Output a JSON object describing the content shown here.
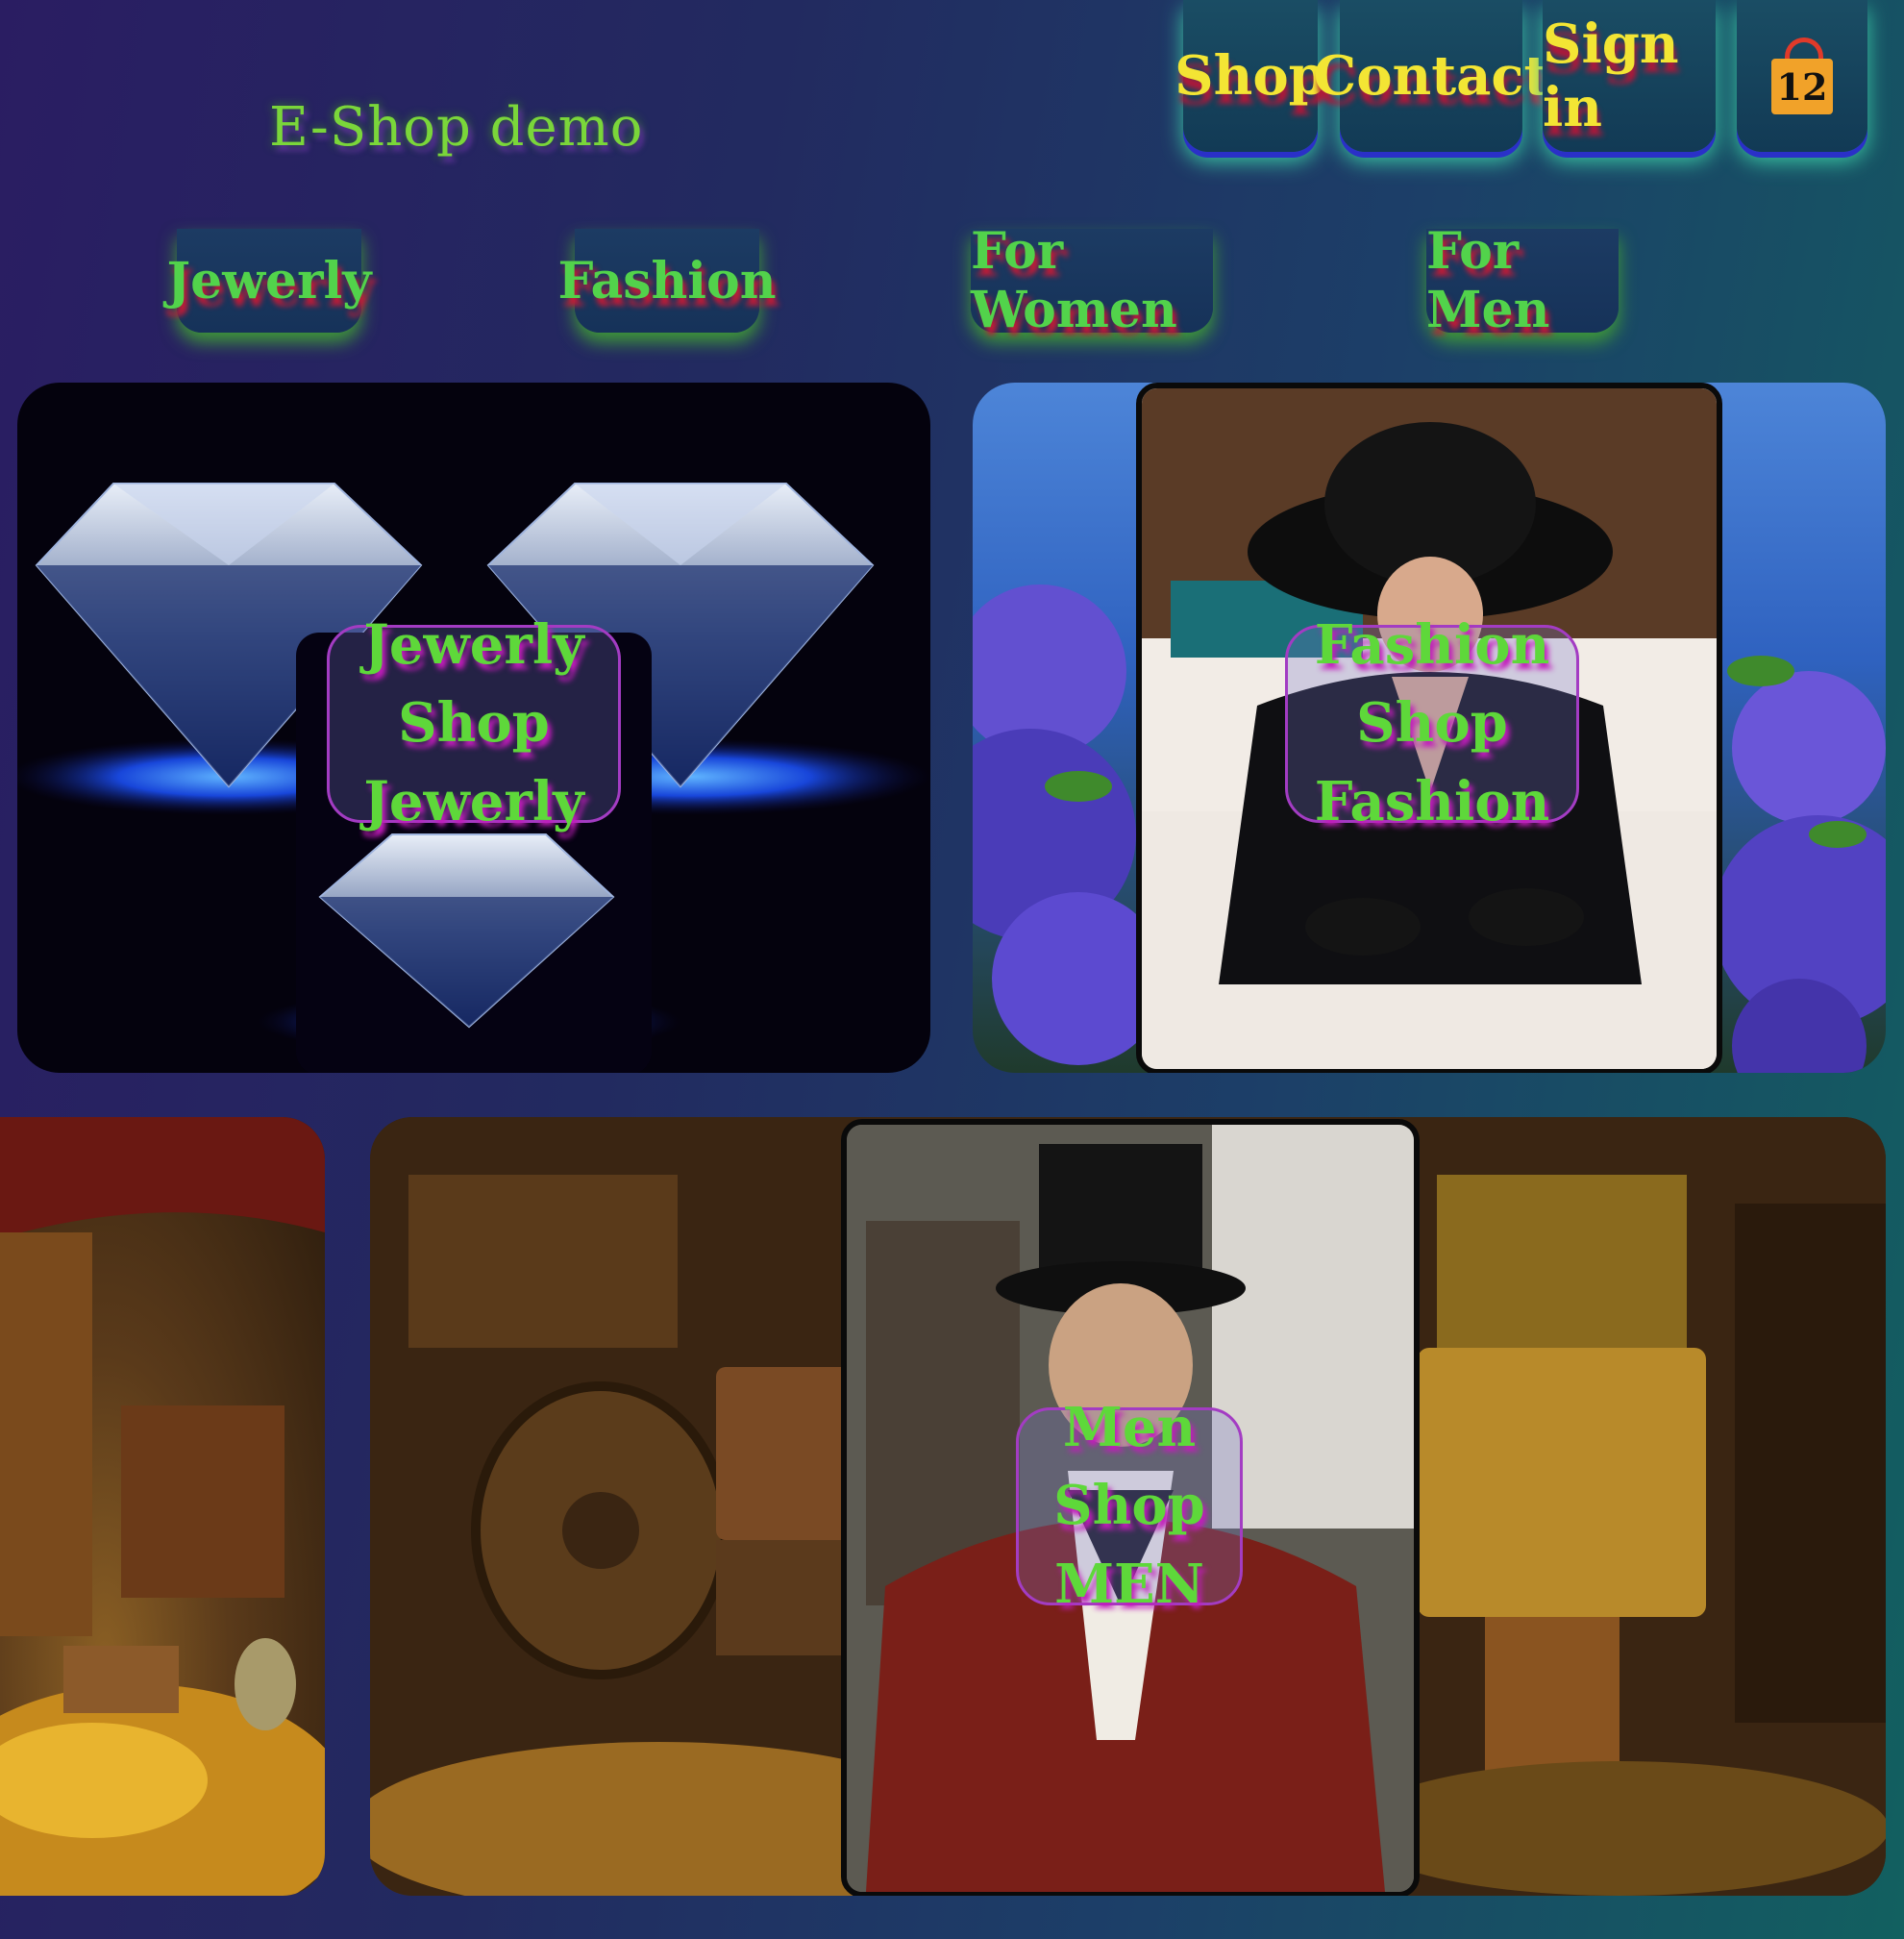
{
  "brand": {
    "title": "E-Shop demo"
  },
  "topnav": {
    "shop": "Shop",
    "contact": "Contact",
    "sign_in": "Sign in",
    "cart_count": "12"
  },
  "categories": {
    "jewelry": "Jewerly",
    "fashion": "Fashion",
    "women": "For Women",
    "men": "For Men"
  },
  "panels": {
    "jewelry": {
      "title": "Jewerly",
      "cta": "Shop Jewerly"
    },
    "fashion": {
      "title": "Fashion",
      "cta": "Shop Fashion"
    },
    "men": {
      "title": "Men",
      "cta": "Shop MEN"
    }
  },
  "colors": {
    "accent_green": "#52d34b",
    "nav_text_yellow": "#f3e534",
    "shadow_red": "#b0183a",
    "overlay_border": "#a33cc3"
  }
}
